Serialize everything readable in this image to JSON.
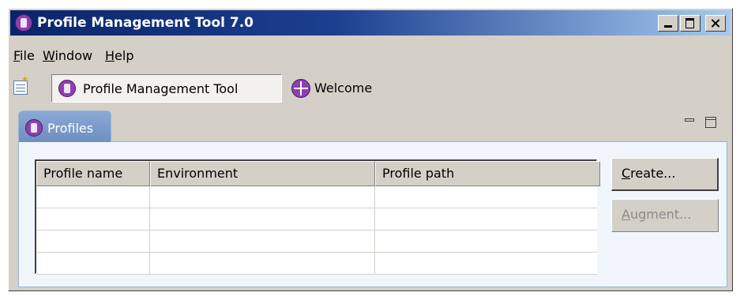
{
  "window": {
    "title": "Profile Management Tool 7.0",
    "icon": "profile-tool-icon",
    "controls": [
      "minimize-icon",
      "maximize-icon",
      "close-icon"
    ]
  },
  "menubar": {
    "file": {
      "mnemonic": "F",
      "rest": "ile"
    },
    "window": {
      "mnemonic": "W",
      "rest": "indow"
    },
    "help": {
      "mnemonic": "H",
      "rest": "elp"
    }
  },
  "toolbar": {
    "open_perspective_icon": "open-perspective-icon",
    "perspectives": [
      {
        "label": "Profile Management Tool",
        "icon": "profile-tool-icon",
        "active": true
      },
      {
        "label": "Welcome",
        "icon": "welcome-icon",
        "active": false
      }
    ]
  },
  "view": {
    "tab_label": "Profiles",
    "table": {
      "columns": [
        "Profile name",
        "Environment",
        "Profile path"
      ],
      "rows": [
        [
          "",
          "",
          ""
        ],
        [
          "",
          "",
          ""
        ],
        [
          "",
          "",
          ""
        ],
        [
          "",
          "",
          ""
        ]
      ]
    },
    "buttons": {
      "create": {
        "mnemonic": "C",
        "rest": "reate...",
        "enabled": true
      },
      "augment": {
        "mnemonic": "A",
        "rest": "ugment...",
        "enabled": false
      }
    }
  },
  "colors": {
    "titlebar_start": "#0a246a",
    "titlebar_end": "#a6caf0",
    "chrome": "#d4d0c8",
    "brand_purple": "#8e3fb0",
    "view_tab": "#6e8fc2"
  }
}
